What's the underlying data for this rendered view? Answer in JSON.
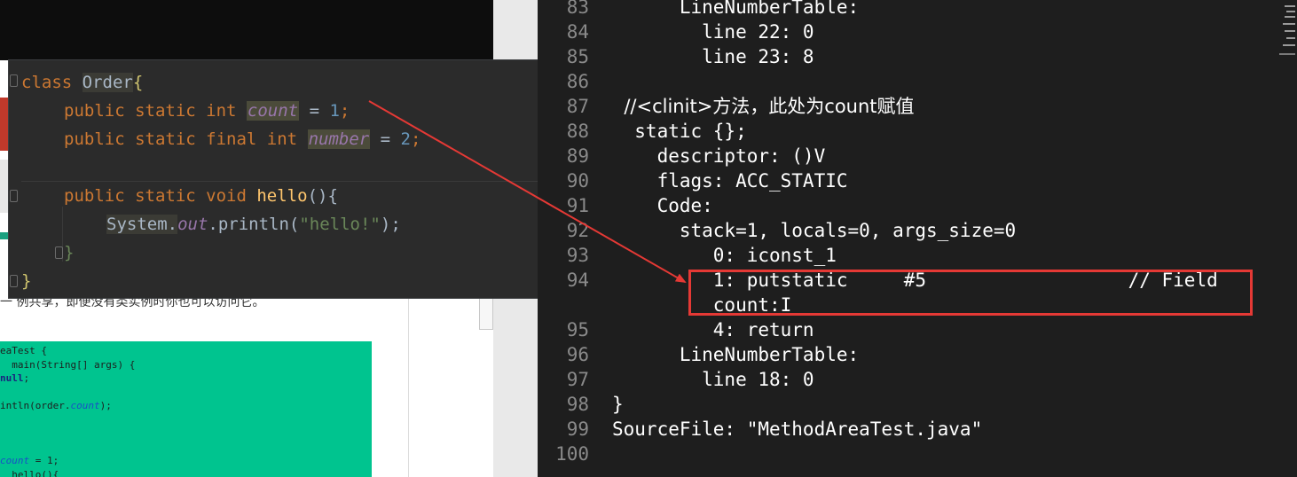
{
  "background_doc": {
    "chinese_text": "一        例共享，即便没有类实例时你也可以访问它。",
    "code_lines": [
      {
        "pre": "eaTest {",
        "kw": "",
        "it": "",
        "post": ""
      },
      {
        "pre": "  main(String[] args) {",
        "kw": "",
        "it": "",
        "post": ""
      },
      {
        "pre": "",
        "kw": "null",
        "it": "",
        "post": ";"
      },
      {
        "pre": "",
        "kw": "",
        "it": "",
        "post": ""
      },
      {
        "pre": "intln(order.",
        "kw": "",
        "it": "count",
        "post": ");"
      },
      {
        "pre": "",
        "kw": "",
        "it": "",
        "post": ""
      },
      {
        "pre": "",
        "kw": "",
        "it": "",
        "post": ""
      },
      {
        "pre": "",
        "kw": "",
        "it": "",
        "post": ""
      },
      {
        "pre": "",
        "kw": "",
        "it": "count",
        "post": " = 1;"
      },
      {
        "pre": "  hello(){",
        "kw": "",
        "it": "",
        "post": ""
      }
    ]
  },
  "ide": {
    "line1": {
      "kw": "class",
      "name": "Order",
      "brace": "{"
    },
    "line2": {
      "kw": "public static int",
      "field": "count",
      "eq": " = ",
      "num": "1",
      "end": ";"
    },
    "line3": {
      "kw": "public static final int",
      "field": "number",
      "eq": " = ",
      "num": "2",
      "end": ";"
    },
    "line4": {
      "kw": "public static void",
      "fn": "hello",
      "rest": "(){"
    },
    "line5": {
      "cls": "System.",
      "field": "out",
      "mid": ".println(",
      "str": "\"hello!\"",
      "end": ");"
    },
    "line6": {
      "brace": "}"
    },
    "line7": {
      "brace": "}"
    }
  },
  "bytecode": {
    "rows": [
      {
        "n": "83",
        "text": "      LineNumberTable:"
      },
      {
        "n": "84",
        "text": "        line 22: 0"
      },
      {
        "n": "85",
        "text": "        line 23: 8"
      },
      {
        "n": "86",
        "text": ""
      },
      {
        "n": "87",
        "text": "  //<clinit>方法，此处为count赋值"
      },
      {
        "n": "88",
        "text": "  static {};"
      },
      {
        "n": "89",
        "text": "    descriptor: ()V"
      },
      {
        "n": "90",
        "text": "    flags: ACC_STATIC"
      },
      {
        "n": "91",
        "text": "    Code:"
      },
      {
        "n": "92",
        "text": "      stack=1, locals=0, args_size=0"
      },
      {
        "n": "93",
        "text": "         0: iconst_1"
      },
      {
        "n": "94",
        "text": "         1: putstatic     #5                  // Field"
      },
      {
        "n": "",
        "text": "         count:I"
      },
      {
        "n": "95",
        "text": "         4: return"
      },
      {
        "n": "96",
        "text": "      LineNumberTable:"
      },
      {
        "n": "97",
        "text": "        line 18: 0"
      },
      {
        "n": "98",
        "text": "}"
      },
      {
        "n": "99",
        "text": "SourceFile: \"MethodAreaTest.java\""
      },
      {
        "n": "100",
        "text": ""
      }
    ]
  },
  "annotation": {
    "color": "#e53935"
  }
}
